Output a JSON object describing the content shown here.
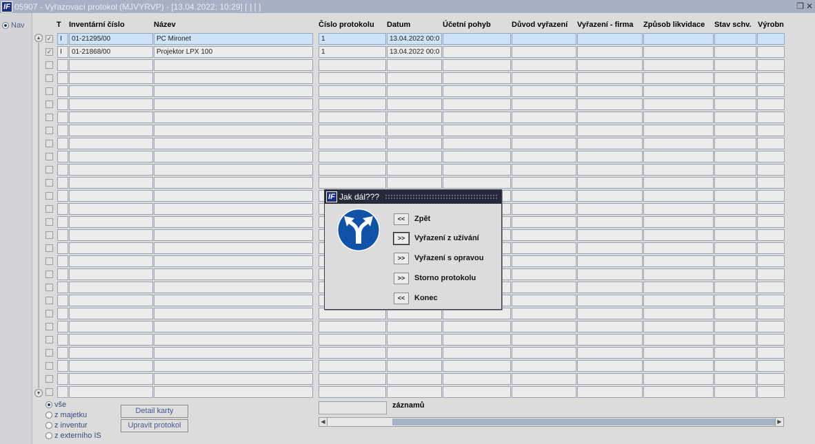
{
  "window": {
    "title": "05907 - Vyřazovací protokol (MJVYRVP) - [13.04.2022; 10:29]  [ ]  [ ]",
    "logo_text": "IF",
    "restore_icon": "restore-icon",
    "close_icon": "close-icon"
  },
  "leftnav": {
    "radio_label": "Nav"
  },
  "table": {
    "headers": {
      "t": "T",
      "inv": "Inventární číslo",
      "nazev": "Název",
      "cislo": "Číslo protokolu",
      "datum": "Datum",
      "pohyb": "Účetní pohyb",
      "duvod": "Důvod vyřazení",
      "firma": "Vyřazení - firma",
      "zpusob": "Způsob likvidace",
      "stav": "Stav schv.",
      "vyrobni": "Výrobn"
    },
    "rows": [
      {
        "checked": true,
        "t": "I",
        "inv": "01-21295/00",
        "nazev": "PC Mironet",
        "cislo": "1",
        "datum": "13.04.2022 00:0",
        "pohyb": "",
        "duvod": "",
        "firma": "",
        "zpusob": "",
        "stav": "",
        "vyrobni": ""
      },
      {
        "checked": true,
        "t": "I",
        "inv": "01-21868/00",
        "nazev": "Projektor LPX 100",
        "cislo": "1",
        "datum": "13.04.2022 00:0",
        "pohyb": "",
        "duvod": "",
        "firma": "",
        "zpusob": "",
        "stav": "",
        "vyrobni": ""
      }
    ],
    "total_visible_rows": 28,
    "selected_row_index": 0
  },
  "filters": [
    {
      "label": "vše",
      "selected": true
    },
    {
      "label": "z majetku",
      "selected": false
    },
    {
      "label": "z inventur",
      "selected": false
    },
    {
      "label": "z externího IS",
      "selected": false
    }
  ],
  "buttons": {
    "detail": "Detail karty",
    "upravit": "Upravit protokol"
  },
  "records": {
    "count_value": "",
    "label": "záznamů"
  },
  "dialog": {
    "title": "Jak dál???",
    "icon": "fork-road-sign-icon",
    "options": [
      {
        "arrow": "<<",
        "label": "Zpět",
        "focused": false
      },
      {
        "arrow": ">>",
        "label": "Vyřazení z užívání",
        "focused": true
      },
      {
        "arrow": ">>",
        "label": "Vyřazení s opravou",
        "focused": false
      },
      {
        "arrow": ">>",
        "label": "Storno protokolu",
        "focused": false
      },
      {
        "arrow": "<<",
        "label": "Konec",
        "focused": false
      }
    ]
  },
  "colors": {
    "titlebar": "#a8b0c4",
    "dialog_titlebar": "#27283a",
    "selected_row": "#cde3f7",
    "sign_blue": "#0f52a8"
  }
}
